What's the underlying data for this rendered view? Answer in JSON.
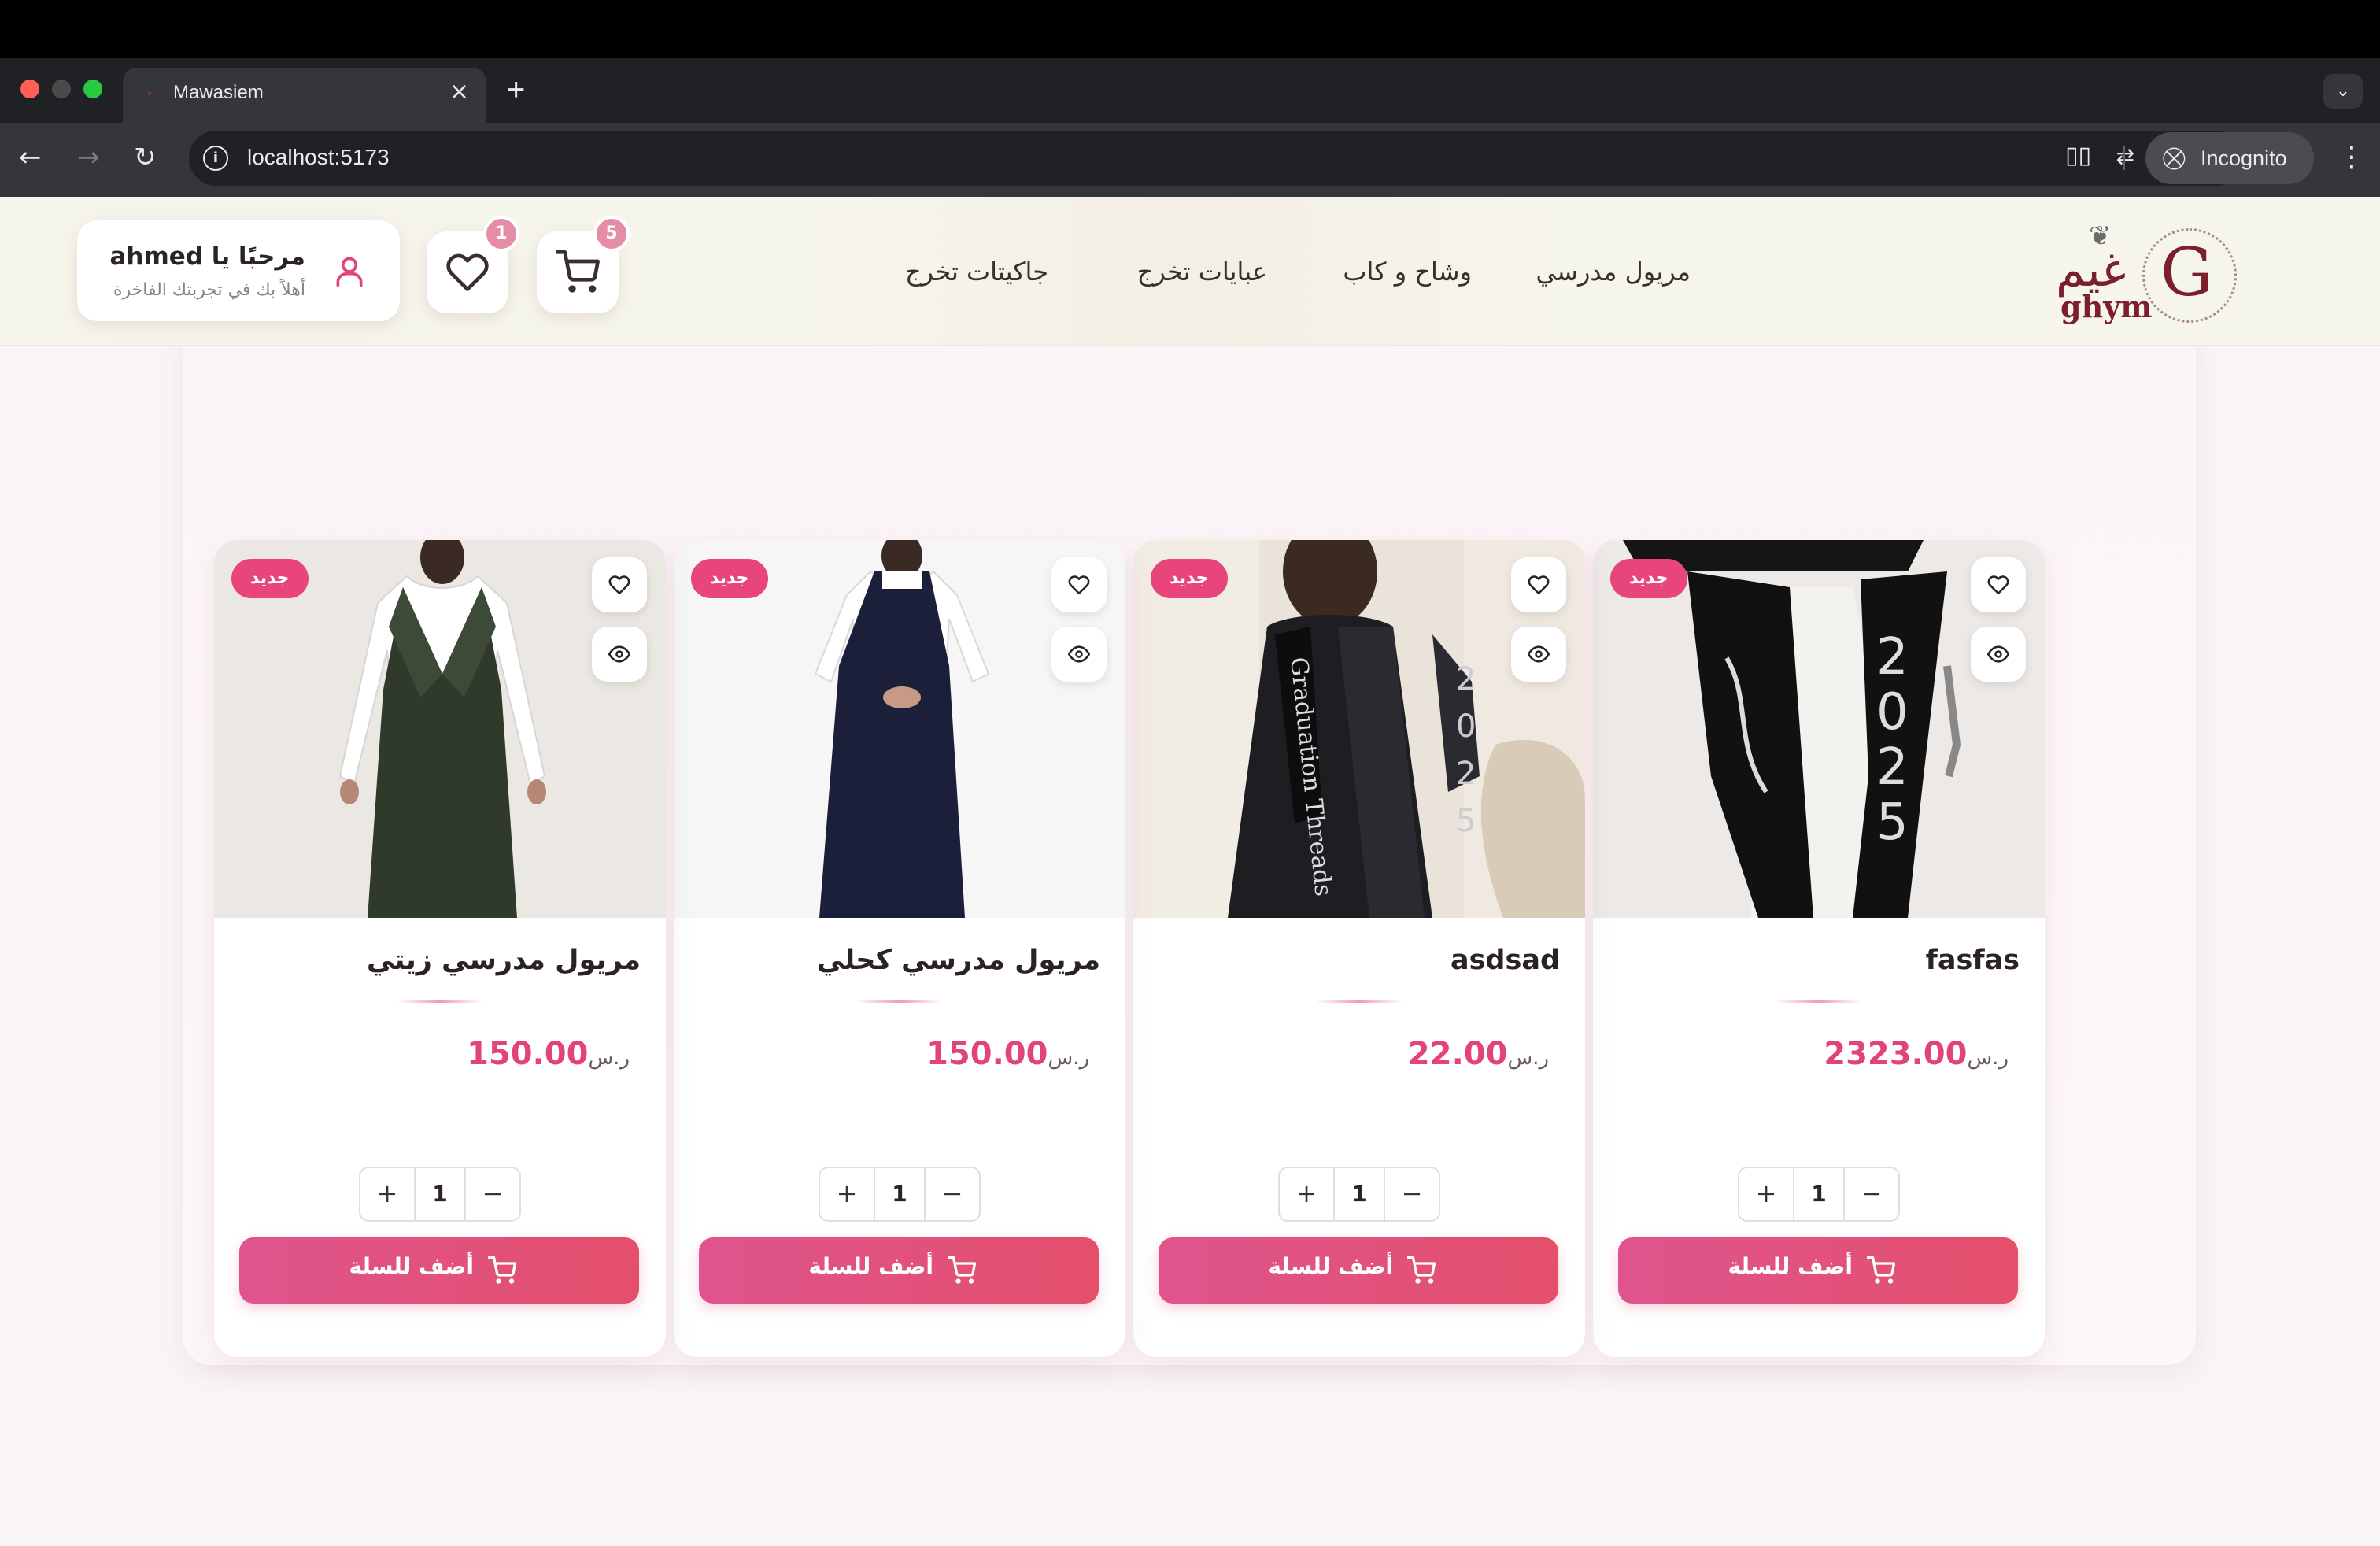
{
  "browser": {
    "tab_title": "Mawasiem",
    "url": "localhost:5173",
    "incognito_label": "Incognito"
  },
  "site": {
    "logo": {
      "arabic": "غيم",
      "latin": "ghym",
      "monogram": "G"
    },
    "nav": [
      "مريول مدرسي",
      "وشاح و كاب",
      "عبايات تخرج",
      "جاكيتات تخرج"
    ],
    "cart_count": "5",
    "wishlist_count": "1",
    "user": {
      "greeting": "مرحبًا يا ahmed",
      "subtitle": "أهلاً بك في تجربتك الفاخرة"
    }
  },
  "products": [
    {
      "badge": "جديد",
      "title": "fasfas",
      "price": "2323.00",
      "currency": "ر.س",
      "quantity": "1",
      "add_label": "أضف للسلة",
      "image": "black graduation sash with 2025 on white garment"
    },
    {
      "badge": "جديد",
      "title": "asdsad",
      "price": "22.00",
      "currency": "ر.س",
      "quantity": "1",
      "add_label": "أضف للسلة",
      "image": "woman in black graduation abaya with Graduation Threads sash"
    },
    {
      "badge": "جديد",
      "title": "مريول مدرسي كحلي",
      "price": "150.00",
      "currency": "ر.س",
      "quantity": "1",
      "add_label": "أضف للسلة",
      "image": "navy school pinafore dress"
    },
    {
      "badge": "جديد",
      "title": "مريول مدرسي زيتي",
      "price": "150.00",
      "currency": "ر.س",
      "quantity": "1",
      "add_label": "أضف للسلة",
      "image": "olive green school pinafore dress"
    }
  ],
  "colors": {
    "accent": "#e2437a",
    "button_gradient_start": "#df548e",
    "button_gradient_end": "#e44f6b",
    "header_bg": "#f6f5ec",
    "logo": "#7a1f2b"
  }
}
